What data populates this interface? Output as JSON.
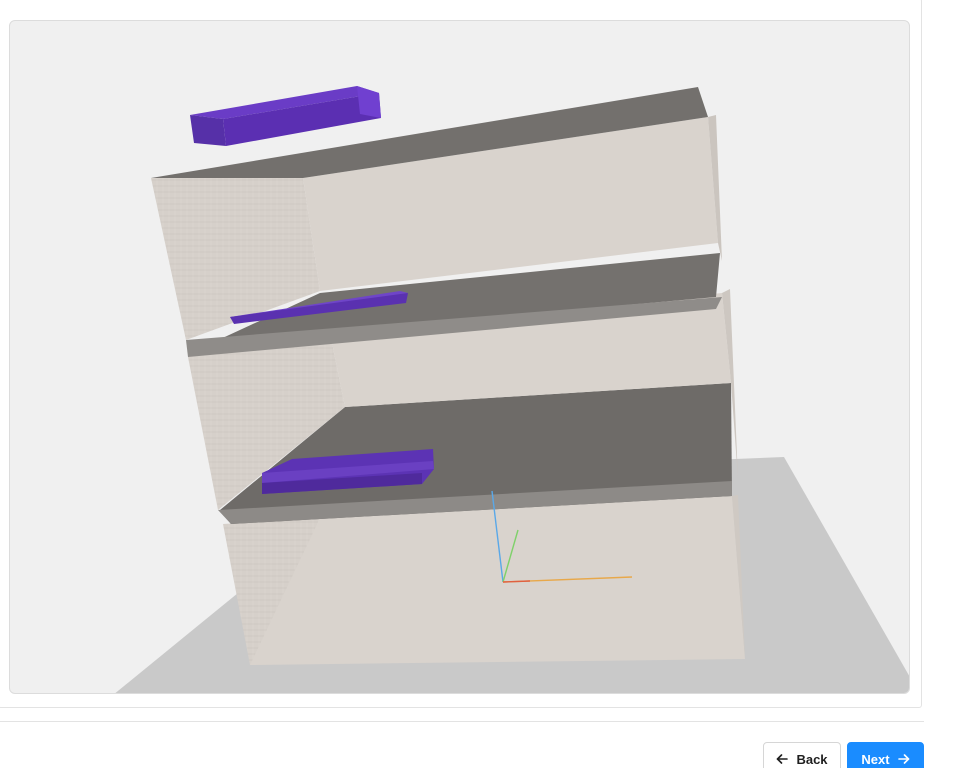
{
  "viewer": {
    "scene_name": "3d-shelf-scene",
    "colors": {
      "background": "#f0f0f0",
      "ground": "#c9c9c9",
      "wall": "#d8d2cc",
      "shelf": "#767370",
      "block": "#5b2fb2",
      "axis_x": "#e8a84a",
      "axis_y": "#7fd16a",
      "axis_z": "#5aa8e8"
    }
  },
  "footer": {
    "back_label": "Back",
    "back_icon": "arrow-left-icon",
    "next_label": "Next",
    "next_icon": "arrow-right-icon",
    "primary_color": "#1a8cff"
  }
}
